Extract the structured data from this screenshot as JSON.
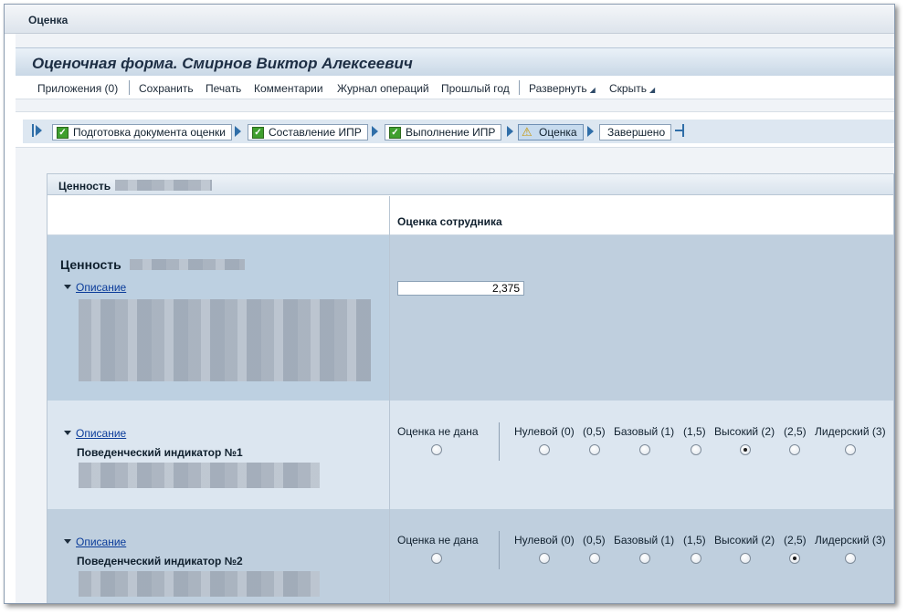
{
  "window": {
    "title": "Оценка"
  },
  "form": {
    "title": "Оценочная форма. Смирнов Виктор Алексеевич"
  },
  "toolbar": {
    "apps": "Приложения (0)",
    "save": "Сохранить",
    "print": "Печать",
    "comments": "Комментарии",
    "log": "Журнал операций",
    "last_year": "Прошлый год",
    "expand": "Развернуть",
    "collapse": "Скрыть"
  },
  "roadmap": {
    "steps": [
      {
        "label": "Подготовка документа оценки",
        "status": "done"
      },
      {
        "label": "Составление ИПР",
        "status": "done"
      },
      {
        "label": "Выполнение ИПР",
        "status": "done"
      },
      {
        "label": "Оценка",
        "status": "current"
      },
      {
        "label": "Завершено",
        "status": "pending"
      }
    ]
  },
  "section": {
    "title": "Ценность",
    "column_header": "Оценка сотрудника",
    "value_block": {
      "title": "Ценность",
      "description_link": "Описание",
      "score": "2,375"
    },
    "indicators": [
      {
        "description_link": "Описание",
        "title": "Поведенческий индикатор №1",
        "selected": "Высокий (2)"
      },
      {
        "description_link": "Описание",
        "title": "Поведенческий индикатор №2",
        "selected": "(2,5)"
      }
    ],
    "rating_options": {
      "none": "Оценка не дана",
      "o0": "Нулевой (0)",
      "o05": "(0,5)",
      "o1": "Базовый (1)",
      "o15": "(1,5)",
      "o2": "Высокий (2)",
      "o25": "(2,5)",
      "o3": "Лидерский (3)"
    }
  }
}
